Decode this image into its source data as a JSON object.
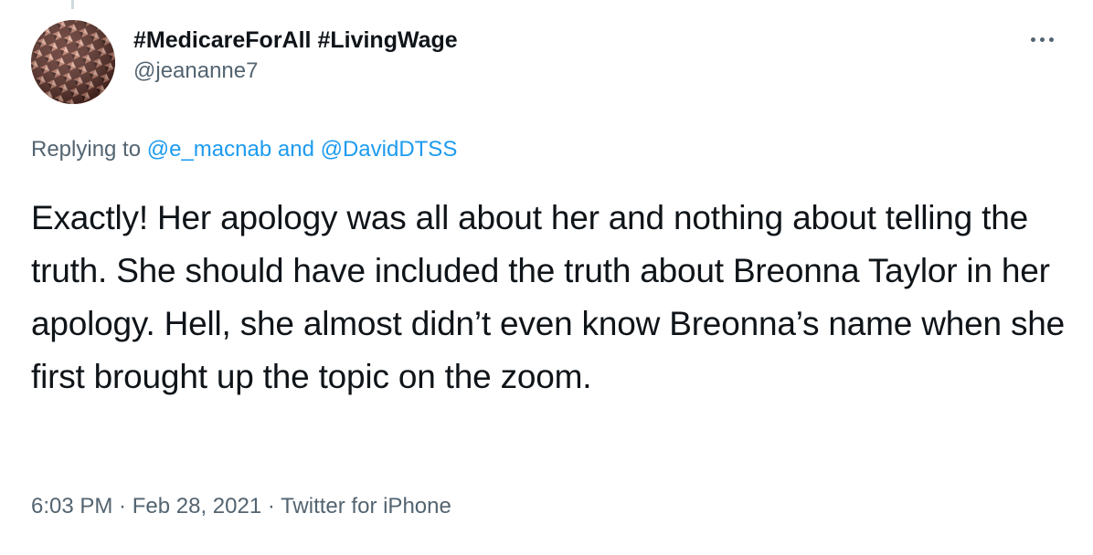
{
  "author": {
    "display_name": "#MedicareForAll #LivingWage",
    "handle": "@jeananne7"
  },
  "more_icon": "more-horizontal-icon",
  "reply_context": {
    "prefix": "Replying to ",
    "mention_1": "@e_macnab",
    "conjunction": " and ",
    "mention_2": "@DavidDTSS"
  },
  "tweet": {
    "text": "Exactly! Her apology was all about her and nothing about telling the truth. She should have included the truth about Breonna Taylor in her apology. Hell, she almost didn’t even know Breonna’s name when she first brought up the topic on the zoom."
  },
  "meta": {
    "time": "6:03 PM",
    "separator_1": " · ",
    "date": "Feb 28, 2021",
    "separator_2": " · ",
    "source": "Twitter for iPhone"
  },
  "colors": {
    "text": "#0f1419",
    "secondary": "#536471",
    "link": "#1d9bf0"
  }
}
